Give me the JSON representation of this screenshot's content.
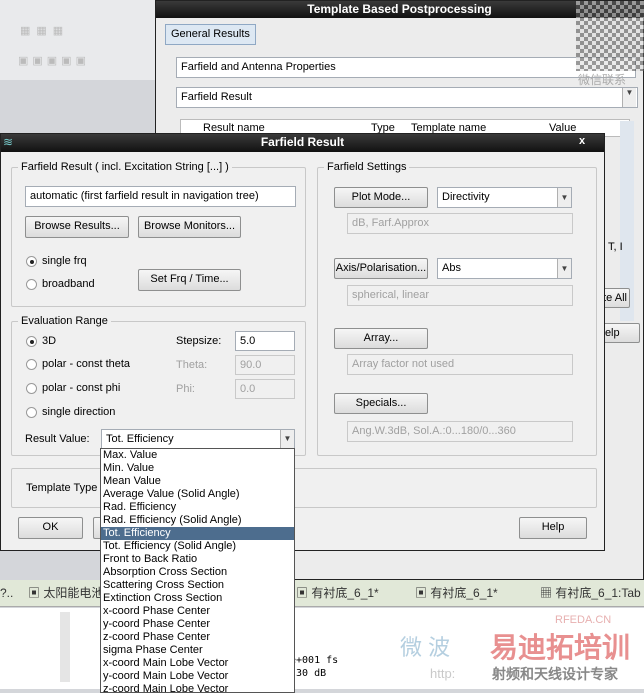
{
  "template_window": {
    "title": "Template Based Postprocessing",
    "tab": "General Results",
    "category": "Farfield and Antenna Properties",
    "template": "Farfield Result",
    "columns": [
      "Result name",
      "Type",
      "Template name",
      "Value"
    ],
    "partial_text": [
      "T, I",
      "ate All",
      "Help"
    ],
    "watermark": "微信联系"
  },
  "dialog": {
    "title": "Farfield Result",
    "close": "x",
    "farfield_result": {
      "legend": "Farfield Result ( incl. Excitation String [...] )",
      "value": "automatic (first farfield result in navigation tree)",
      "browse_results": "Browse Results...",
      "browse_monitors": "Browse Monitors...",
      "single_frq": "single frq",
      "broadband": "broadband",
      "set_frq": "Set Frq / Time...",
      "mode": "single frq"
    },
    "evaluation": {
      "legend": "Evaluation Range",
      "r3d": "3D",
      "polar_theta": "polar - const theta",
      "polar_phi": "polar - const phi",
      "single_dir": "single direction",
      "stepsize_label": "Stepsize:",
      "stepsize": "5.0",
      "theta_label": "Theta:",
      "theta": "90.0",
      "phi_label": "Phi:",
      "phi": "0.0",
      "result_value_label": "Result Value:",
      "result_value": "Tot. Efficiency",
      "selected": "3D"
    },
    "settings": {
      "legend": "Farfield Settings",
      "plot_mode": "Plot Mode...",
      "plot_mode_value": "Directivity",
      "plot_mode_info": "dB, Farf.Approx",
      "axis": "Axis/Polarisation...",
      "axis_value": "Abs",
      "axis_info": "spherical, linear",
      "array": "Array...",
      "array_info": "Array factor not used",
      "specials": "Specials...",
      "specials_info": "Ang.W.3dB, Sol.A.:0...180/0...360"
    },
    "template_type": "Template Type",
    "ok": "OK",
    "help": "Help"
  },
  "dropdown": {
    "items": [
      "Max. Value",
      "Min. Value",
      "Mean Value",
      "Average Value (Solid Angle)",
      "Rad. Efficiency",
      "Rad. Efficiency (Solid Angle)",
      "Tot. Efficiency",
      "Tot. Efficiency (Solid Angle)",
      "Front to Back Ratio",
      "Absorption Cross Section",
      "Scattering Cross Section",
      "Extinction Cross Section",
      "x-coord Phase Center",
      "y-coord Phase Center",
      "z-coord Phase Center",
      "sigma Phase Center",
      "x-coord Main Lobe Vector",
      "y-coord Main Lobe Vector",
      "z-coord Main Lobe Vector"
    ],
    "selected": "Tot. Efficiency"
  },
  "bottom_tabs": [
    "?..",
    "太阳能电池",
    "有衬底_6_1*",
    "有衬底_6_1*",
    "有衬底_6_1:Tab"
  ],
  "log_lines": [
    "e+001  fs",
    "-30  dB"
  ],
  "watermark": {
    "site": "RFEDA.CN",
    "brand": "易迪拓培训",
    "slogan": "射频和天线设计专家",
    "cn": "微 波",
    "url": "http:"
  }
}
